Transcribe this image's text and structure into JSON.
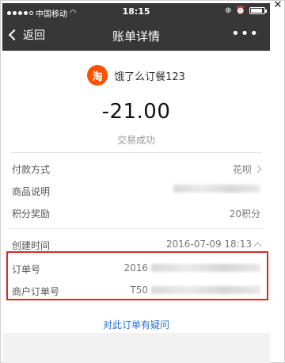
{
  "status_bar": {
    "carrier": "中国移动",
    "time": "18:15",
    "battery": "battery-full"
  },
  "nav": {
    "back_label": "返回",
    "title": "账单详情",
    "more": "•••"
  },
  "merchant": {
    "icon_char": "淘",
    "name": "饿了么订餐123"
  },
  "transaction": {
    "amount": "-21.00",
    "status": "交易成功"
  },
  "details": [
    {
      "label": "付款方式",
      "value": "花呗"
    },
    {
      "label": "商品说明",
      "value": ""
    },
    {
      "label": "积分奖励",
      "value": "20积分"
    }
  ],
  "order_info": {
    "created_label": "创建时间",
    "created_value": "2016-07-09 18:13",
    "order_no_label": "订单号",
    "order_no_prefix": "2016",
    "merchant_order_label": "商户订单号",
    "merchant_order_prefix": "T50"
  },
  "links": {
    "question": "对此订单有疑问"
  },
  "colors": {
    "nav_bg": "#373737",
    "accent_blue": "#2a6fd6",
    "highlight_red": "#e12626",
    "taobao_orange": "#ff5000"
  }
}
